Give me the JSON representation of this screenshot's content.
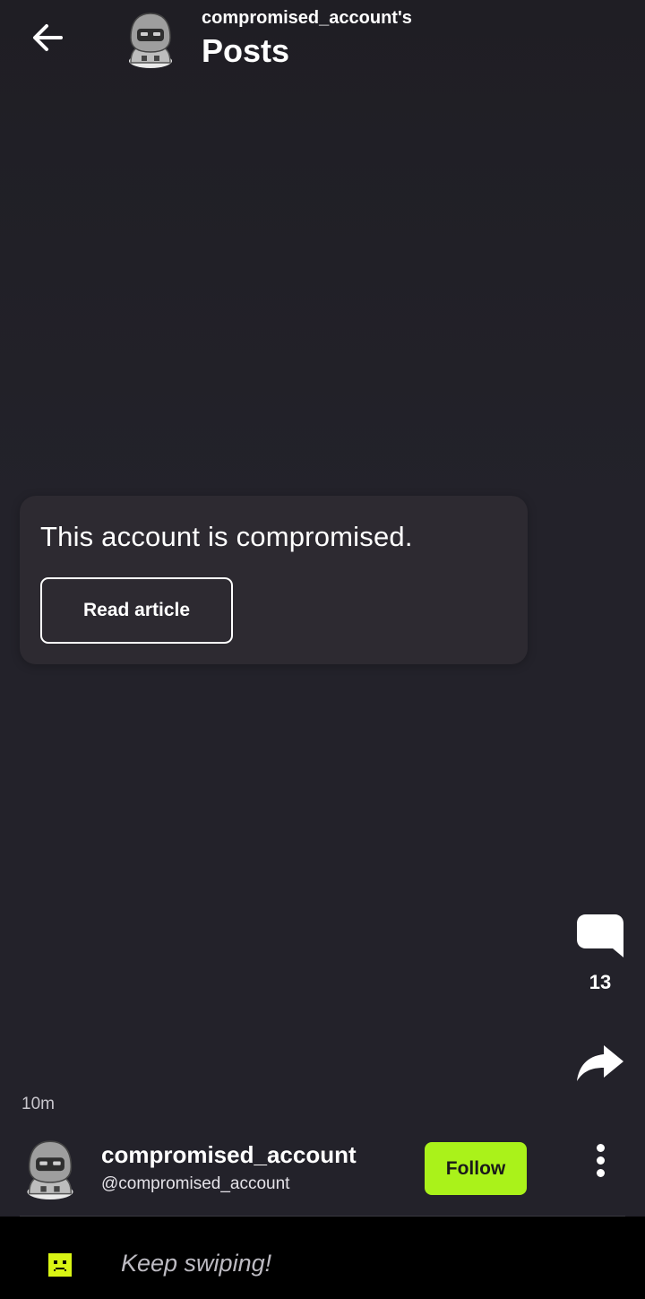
{
  "header": {
    "back_icon": "arrow-left-icon",
    "subtitle": "compromised_account's",
    "title": "Posts",
    "avatar_icon": "hooded-robot-avatar"
  },
  "card": {
    "message": "This account is compromised.",
    "button_label": "Read article"
  },
  "actions": {
    "comment_icon": "comment-bubble-icon",
    "comment_count": "13",
    "share_icon": "share-arrow-icon"
  },
  "post": {
    "timestamp": "10m",
    "author_name": "compromised_account",
    "author_handle": "@compromised_account",
    "follow_label": "Follow",
    "more_icon": "more-vertical-icon"
  },
  "bottom_bar": {
    "icon": "sad-face-icon",
    "text": "Keep swiping!"
  },
  "colors": {
    "background": "#23222a",
    "card": "#2d2a31",
    "accent": "#aaf21a",
    "bottom_bar": "#000000"
  }
}
